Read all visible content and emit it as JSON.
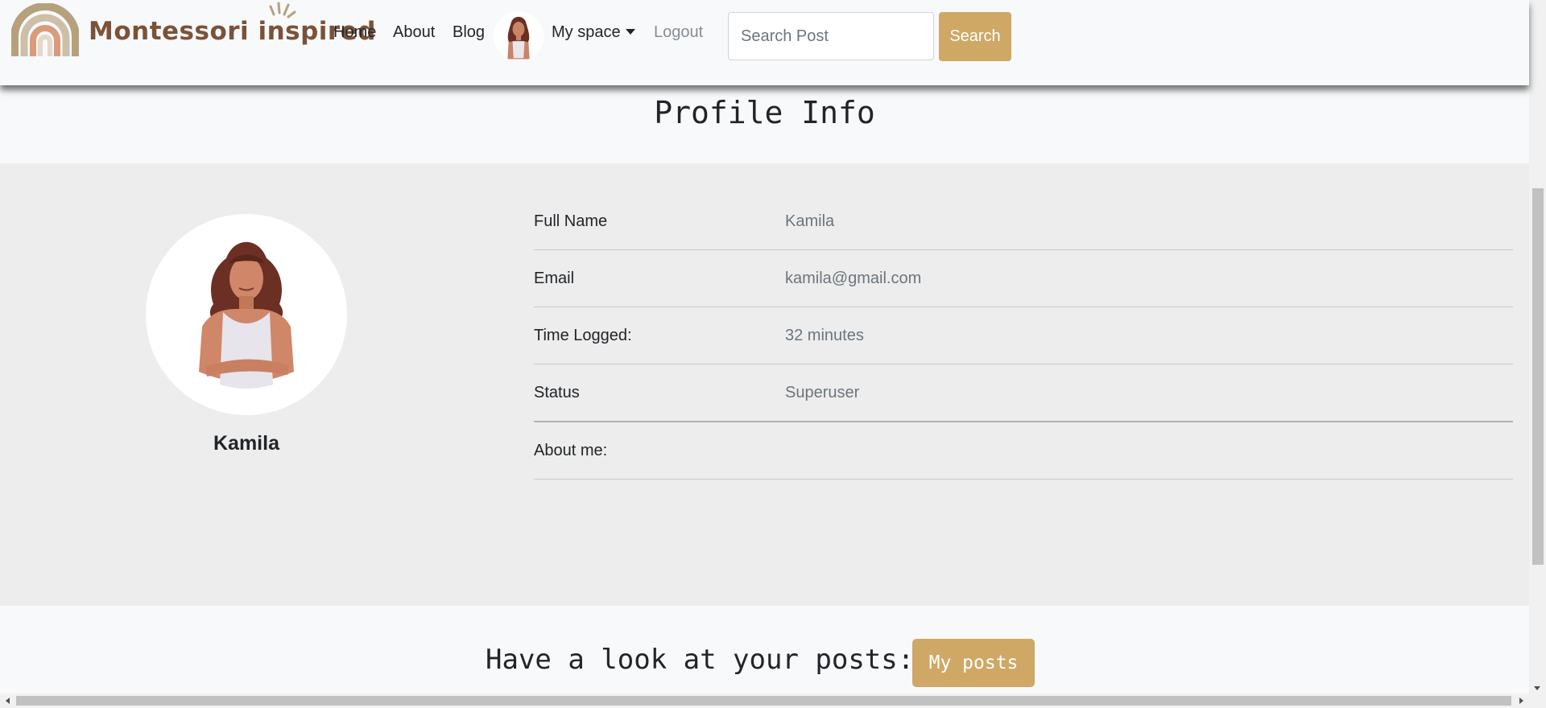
{
  "navbar": {
    "brand": "Montessori inspired",
    "links": {
      "home": "Home",
      "about": "About",
      "blog": "Blog",
      "my_space": "My space",
      "logout": "Logout"
    },
    "search": {
      "placeholder": "Search Post",
      "value": "",
      "button": "Search"
    }
  },
  "page_title": "Profile Info",
  "profile": {
    "name": "Kamila",
    "fields": [
      {
        "label": "Full Name",
        "value": "Kamila"
      },
      {
        "label": "Email",
        "value": "kamila@gmail.com"
      },
      {
        "label": "Time Logged:",
        "value": "32 minutes"
      },
      {
        "label": "Status",
        "value": "Superuser"
      },
      {
        "label": "About me:",
        "value": ""
      }
    ]
  },
  "posts": {
    "prompt": "Have a look at your posts:",
    "button": "My posts"
  },
  "colors": {
    "accent": "#cfa866",
    "brand_text": "#7b5238",
    "section_bg": "#ededed",
    "page_bg": "#f8f9fa",
    "muted_text": "#6c757d"
  },
  "icons": {
    "logo": "rainbow-logo-icon",
    "avatar": "woman-avatar-icon",
    "dropdown": "caret-down-icon"
  }
}
